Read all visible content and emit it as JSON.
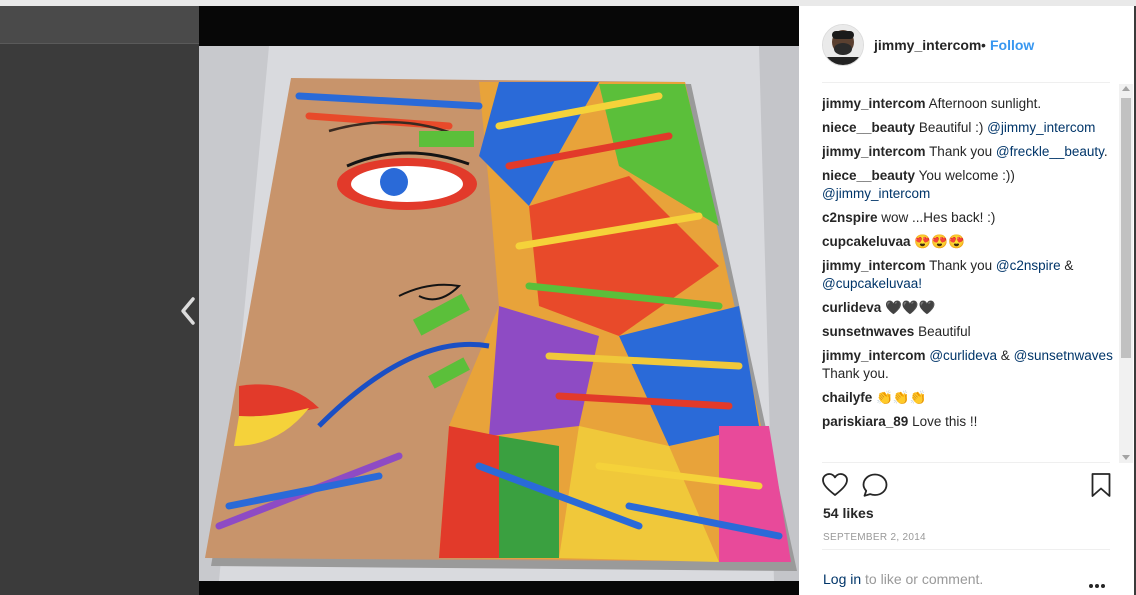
{
  "post": {
    "username": "jimmy_intercom",
    "separator": "•",
    "follow_label": "Follow",
    "likes": "54 likes",
    "date": "SEPTEMBER 2, 2014",
    "login_link": "Log in",
    "login_text": " to like or comment."
  },
  "comments": [
    {
      "user": "jimmy_intercom",
      "parts": [
        {
          "t": "text",
          "v": "Afternoon sunlight."
        }
      ]
    },
    {
      "user": "niece__beauty",
      "parts": [
        {
          "t": "text",
          "v": "Beautiful :) "
        },
        {
          "t": "mention",
          "v": "@jimmy_intercom"
        }
      ]
    },
    {
      "user": "jimmy_intercom",
      "parts": [
        {
          "t": "text",
          "v": "Thank you "
        },
        {
          "t": "mention",
          "v": "@freckle__beauty"
        },
        {
          "t": "text",
          "v": "."
        }
      ]
    },
    {
      "user": "niece__beauty",
      "parts": [
        {
          "t": "text",
          "v": "You welcome :)) "
        },
        {
          "t": "mention",
          "v": "@jimmy_intercom"
        }
      ]
    },
    {
      "user": "c2nspire",
      "parts": [
        {
          "t": "text",
          "v": "wow ...Hes back! :)"
        }
      ]
    },
    {
      "user": "cupcakeluvaa",
      "parts": [
        {
          "t": "text",
          "v": "😍😍😍"
        }
      ]
    },
    {
      "user": "jimmy_intercom",
      "parts": [
        {
          "t": "text",
          "v": "Thank you "
        },
        {
          "t": "mention",
          "v": "@c2nspire"
        },
        {
          "t": "text",
          "v": " & "
        },
        {
          "t": "mention",
          "v": "@cupcakeluvaa!"
        }
      ]
    },
    {
      "user": "curlideva",
      "parts": [
        {
          "t": "text",
          "v": "🖤🖤🖤"
        }
      ]
    },
    {
      "user": "sunsetnwaves",
      "parts": [
        {
          "t": "text",
          "v": "Beautiful"
        }
      ]
    },
    {
      "user": "jimmy_intercom",
      "parts": [
        {
          "t": "mention",
          "v": "@curlideva"
        },
        {
          "t": "text",
          "v": " & "
        },
        {
          "t": "mention",
          "v": "@sunsetnwaves"
        },
        {
          "t": "text",
          "v": " Thank you."
        }
      ]
    },
    {
      "user": "chailyfe",
      "parts": [
        {
          "t": "text",
          "v": "👏👏👏"
        }
      ]
    },
    {
      "user": "pariskiara_89",
      "parts": [
        {
          "t": "text",
          "v": "Love this !!"
        }
      ]
    }
  ],
  "icons": {
    "avatar": "user-avatar",
    "like": "heart-icon",
    "comment": "comment-bubble-icon",
    "save": "bookmark-icon",
    "more": "more-options-icon",
    "previous": "chevron-left-icon"
  },
  "colors": {
    "link_blue": "#3897f0",
    "mention_blue": "#003569",
    "text": "#262626",
    "muted": "#999999"
  }
}
